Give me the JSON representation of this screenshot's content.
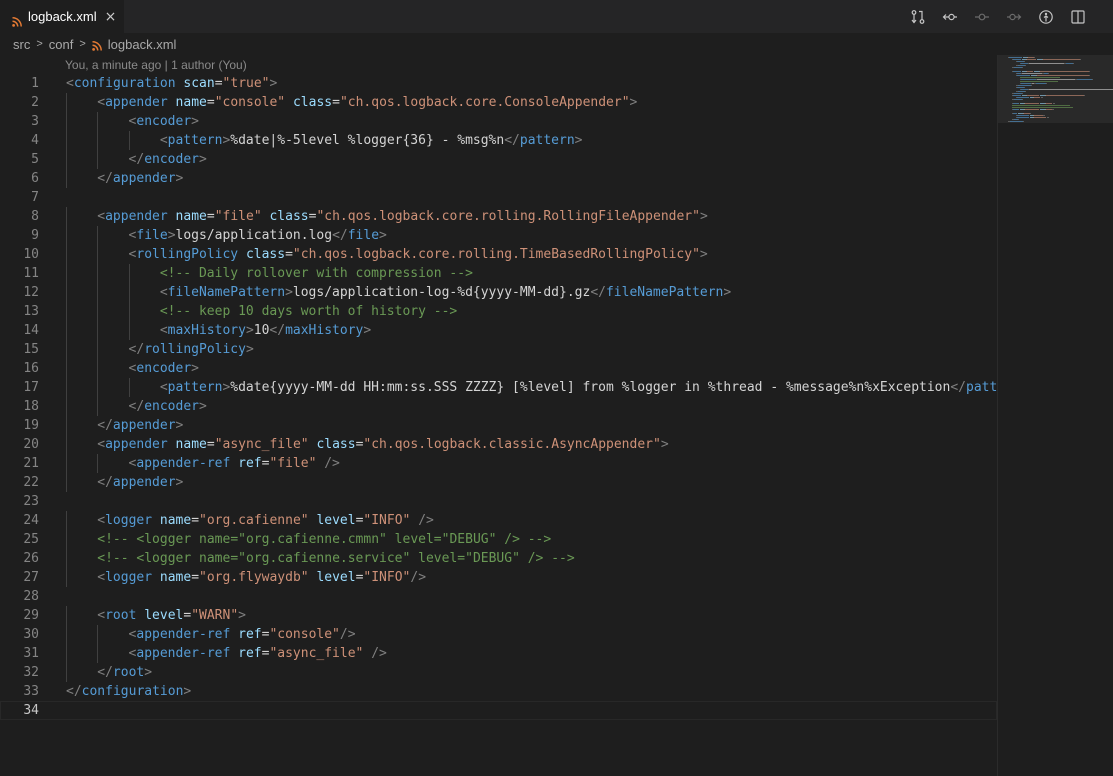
{
  "tab": {
    "label": "logback.xml",
    "close_glyph": "×",
    "file_icon": "rss-icon",
    "file_icon_color": "#e37933"
  },
  "actions": [
    {
      "name": "open-changes-icon",
      "enabled": true
    },
    {
      "name": "previous-change-icon",
      "enabled": true
    },
    {
      "name": "git-commit-icon",
      "enabled": false
    },
    {
      "name": "next-change-icon",
      "enabled": false
    },
    {
      "name": "toggle-blame-icon",
      "enabled": true
    },
    {
      "name": "split-editor-icon",
      "enabled": true
    }
  ],
  "breadcrumb": {
    "items": [
      "src",
      "conf",
      "logback.xml"
    ],
    "separator": ">"
  },
  "blame": {
    "text": "You, a minute ago | 1 author (You)"
  },
  "editor": {
    "current_line": 34,
    "colors": {
      "bracket": "#808080",
      "tag": "#569cd6",
      "attribute": "#9cdcfe",
      "string": "#ce9178",
      "text": "#d4d4d4",
      "comment": "#6a9955"
    },
    "lines": [
      {
        "n": "1",
        "indent": 0,
        "tokens": [
          [
            "br",
            "<"
          ],
          [
            "tag",
            "configuration"
          ],
          [
            "txt",
            " "
          ],
          [
            "attr",
            "scan"
          ],
          [
            "eq",
            "="
          ],
          [
            "str",
            "\"true\""
          ],
          [
            "br",
            ">"
          ]
        ]
      },
      {
        "n": "2",
        "indent": 1,
        "tokens": [
          [
            "br",
            "<"
          ],
          [
            "tag",
            "appender"
          ],
          [
            "txt",
            " "
          ],
          [
            "attr",
            "name"
          ],
          [
            "eq",
            "="
          ],
          [
            "str",
            "\"console\""
          ],
          [
            "txt",
            " "
          ],
          [
            "attr",
            "class"
          ],
          [
            "eq",
            "="
          ],
          [
            "str",
            "\"ch.qos.logback.core.ConsoleAppender\""
          ],
          [
            "br",
            ">"
          ]
        ]
      },
      {
        "n": "3",
        "indent": 2,
        "tokens": [
          [
            "br",
            "<"
          ],
          [
            "tag",
            "encoder"
          ],
          [
            "br",
            ">"
          ]
        ]
      },
      {
        "n": "4",
        "indent": 3,
        "tokens": [
          [
            "br",
            "<"
          ],
          [
            "tag",
            "pattern"
          ],
          [
            "br",
            ">"
          ],
          [
            "txt",
            "%date|%-5level %logger{36} - %msg%n"
          ],
          [
            "br",
            "</"
          ],
          [
            "tag",
            "pattern"
          ],
          [
            "br",
            ">"
          ]
        ]
      },
      {
        "n": "5",
        "indent": 2,
        "tokens": [
          [
            "br",
            "</"
          ],
          [
            "tag",
            "encoder"
          ],
          [
            "br",
            ">"
          ]
        ]
      },
      {
        "n": "6",
        "indent": 1,
        "tokens": [
          [
            "br",
            "</"
          ],
          [
            "tag",
            "appender"
          ],
          [
            "br",
            ">"
          ]
        ]
      },
      {
        "n": "7",
        "indent": 0,
        "tokens": []
      },
      {
        "n": "8",
        "indent": 1,
        "tokens": [
          [
            "br",
            "<"
          ],
          [
            "tag",
            "appender"
          ],
          [
            "txt",
            " "
          ],
          [
            "attr",
            "name"
          ],
          [
            "eq",
            "="
          ],
          [
            "str",
            "\"file\""
          ],
          [
            "txt",
            " "
          ],
          [
            "attr",
            "class"
          ],
          [
            "eq",
            "="
          ],
          [
            "str",
            "\"ch.qos.logback.core.rolling.RollingFileAppender\""
          ],
          [
            "br",
            ">"
          ]
        ]
      },
      {
        "n": "9",
        "indent": 2,
        "tokens": [
          [
            "br",
            "<"
          ],
          [
            "tag",
            "file"
          ],
          [
            "br",
            ">"
          ],
          [
            "txt",
            "logs/application.log"
          ],
          [
            "br",
            "</"
          ],
          [
            "tag",
            "file"
          ],
          [
            "br",
            ">"
          ]
        ]
      },
      {
        "n": "10",
        "indent": 2,
        "tokens": [
          [
            "br",
            "<"
          ],
          [
            "tag",
            "rollingPolicy"
          ],
          [
            "txt",
            " "
          ],
          [
            "attr",
            "class"
          ],
          [
            "eq",
            "="
          ],
          [
            "str",
            "\"ch.qos.logback.core.rolling.TimeBasedRollingPolicy\""
          ],
          [
            "br",
            ">"
          ]
        ]
      },
      {
        "n": "11",
        "indent": 3,
        "tokens": [
          [
            "com",
            "<!-- Daily rollover with compression -->"
          ]
        ]
      },
      {
        "n": "12",
        "indent": 3,
        "tokens": [
          [
            "br",
            "<"
          ],
          [
            "tag",
            "fileNamePattern"
          ],
          [
            "br",
            ">"
          ],
          [
            "txt",
            "logs/application-log-%d{yyyy-MM-dd}.gz"
          ],
          [
            "br",
            "</"
          ],
          [
            "tag",
            "fileNamePattern"
          ],
          [
            "br",
            ">"
          ]
        ]
      },
      {
        "n": "13",
        "indent": 3,
        "tokens": [
          [
            "com",
            "<!-- keep 10 days worth of history -->"
          ]
        ]
      },
      {
        "n": "14",
        "indent": 3,
        "tokens": [
          [
            "br",
            "<"
          ],
          [
            "tag",
            "maxHistory"
          ],
          [
            "br",
            ">"
          ],
          [
            "txt",
            "10"
          ],
          [
            "br",
            "</"
          ],
          [
            "tag",
            "maxHistory"
          ],
          [
            "br",
            ">"
          ]
        ]
      },
      {
        "n": "15",
        "indent": 2,
        "tokens": [
          [
            "br",
            "</"
          ],
          [
            "tag",
            "rollingPolicy"
          ],
          [
            "br",
            ">"
          ]
        ]
      },
      {
        "n": "16",
        "indent": 2,
        "tokens": [
          [
            "br",
            "<"
          ],
          [
            "tag",
            "encoder"
          ],
          [
            "br",
            ">"
          ]
        ]
      },
      {
        "n": "17",
        "indent": 3,
        "tokens": [
          [
            "br",
            "<"
          ],
          [
            "tag",
            "pattern"
          ],
          [
            "br",
            ">"
          ],
          [
            "txt",
            "%date{yyyy-MM-dd HH:mm:ss.SSS ZZZZ} [%level] from %logger in %thread - %message%n%xException"
          ],
          [
            "br",
            "</"
          ],
          [
            "tag",
            "pattern"
          ],
          [
            "br",
            ">"
          ]
        ]
      },
      {
        "n": "18",
        "indent": 2,
        "tokens": [
          [
            "br",
            "</"
          ],
          [
            "tag",
            "encoder"
          ],
          [
            "br",
            ">"
          ]
        ]
      },
      {
        "n": "19",
        "indent": 1,
        "tokens": [
          [
            "br",
            "</"
          ],
          [
            "tag",
            "appender"
          ],
          [
            "br",
            ">"
          ]
        ]
      },
      {
        "n": "20",
        "indent": 1,
        "tokens": [
          [
            "br",
            "<"
          ],
          [
            "tag",
            "appender"
          ],
          [
            "txt",
            " "
          ],
          [
            "attr",
            "name"
          ],
          [
            "eq",
            "="
          ],
          [
            "str",
            "\"async_file\""
          ],
          [
            "txt",
            " "
          ],
          [
            "attr",
            "class"
          ],
          [
            "eq",
            "="
          ],
          [
            "str",
            "\"ch.qos.logback.classic.AsyncAppender\""
          ],
          [
            "br",
            ">"
          ]
        ]
      },
      {
        "n": "21",
        "indent": 2,
        "tokens": [
          [
            "br",
            "<"
          ],
          [
            "tag",
            "appender-ref"
          ],
          [
            "txt",
            " "
          ],
          [
            "attr",
            "ref"
          ],
          [
            "eq",
            "="
          ],
          [
            "str",
            "\"file\""
          ],
          [
            "txt",
            " "
          ],
          [
            "br",
            "/>"
          ]
        ]
      },
      {
        "n": "22",
        "indent": 1,
        "tokens": [
          [
            "br",
            "</"
          ],
          [
            "tag",
            "appender"
          ],
          [
            "br",
            ">"
          ]
        ]
      },
      {
        "n": "23",
        "indent": 0,
        "tokens": []
      },
      {
        "n": "24",
        "indent": 1,
        "tokens": [
          [
            "br",
            "<"
          ],
          [
            "tag",
            "logger"
          ],
          [
            "txt",
            " "
          ],
          [
            "attr",
            "name"
          ],
          [
            "eq",
            "="
          ],
          [
            "str",
            "\"org.cafienne\""
          ],
          [
            "txt",
            " "
          ],
          [
            "attr",
            "level"
          ],
          [
            "eq",
            "="
          ],
          [
            "str",
            "\"INFO\""
          ],
          [
            "txt",
            " "
          ],
          [
            "br",
            "/>"
          ]
        ]
      },
      {
        "n": "25",
        "indent": 1,
        "tokens": [
          [
            "com",
            "<!-- <logger name=\"org.cafienne.cmmn\" level=\"DEBUG\" /> -->"
          ]
        ]
      },
      {
        "n": "26",
        "indent": 1,
        "tokens": [
          [
            "com",
            "<!-- <logger name=\"org.cafienne.service\" level=\"DEBUG\" /> -->"
          ]
        ]
      },
      {
        "n": "27",
        "indent": 1,
        "tokens": [
          [
            "br",
            "<"
          ],
          [
            "tag",
            "logger"
          ],
          [
            "txt",
            " "
          ],
          [
            "attr",
            "name"
          ],
          [
            "eq",
            "="
          ],
          [
            "str",
            "\"org.flywaydb\""
          ],
          [
            "txt",
            " "
          ],
          [
            "attr",
            "level"
          ],
          [
            "eq",
            "="
          ],
          [
            "str",
            "\"INFO\""
          ],
          [
            "br",
            "/>"
          ]
        ]
      },
      {
        "n": "28",
        "indent": 0,
        "tokens": []
      },
      {
        "n": "29",
        "indent": 1,
        "tokens": [
          [
            "br",
            "<"
          ],
          [
            "tag",
            "root"
          ],
          [
            "txt",
            " "
          ],
          [
            "attr",
            "level"
          ],
          [
            "eq",
            "="
          ],
          [
            "str",
            "\"WARN\""
          ],
          [
            "br",
            ">"
          ]
        ]
      },
      {
        "n": "30",
        "indent": 2,
        "tokens": [
          [
            "br",
            "<"
          ],
          [
            "tag",
            "appender-ref"
          ],
          [
            "txt",
            " "
          ],
          [
            "attr",
            "ref"
          ],
          [
            "eq",
            "="
          ],
          [
            "str",
            "\"console\""
          ],
          [
            "br",
            "/>"
          ]
        ]
      },
      {
        "n": "31",
        "indent": 2,
        "tokens": [
          [
            "br",
            "<"
          ],
          [
            "tag",
            "appender-ref"
          ],
          [
            "txt",
            " "
          ],
          [
            "attr",
            "ref"
          ],
          [
            "eq",
            "="
          ],
          [
            "str",
            "\"async_file\""
          ],
          [
            "txt",
            " "
          ],
          [
            "br",
            "/>"
          ]
        ]
      },
      {
        "n": "32",
        "indent": 1,
        "tokens": [
          [
            "br",
            "</"
          ],
          [
            "tag",
            "root"
          ],
          [
            "br",
            ">"
          ]
        ]
      },
      {
        "n": "33",
        "indent": 0,
        "tokens": [
          [
            "br",
            "</"
          ],
          [
            "tag",
            "configuration"
          ],
          [
            "br",
            ">"
          ]
        ]
      },
      {
        "n": "34",
        "indent": 0,
        "tokens": []
      }
    ]
  }
}
